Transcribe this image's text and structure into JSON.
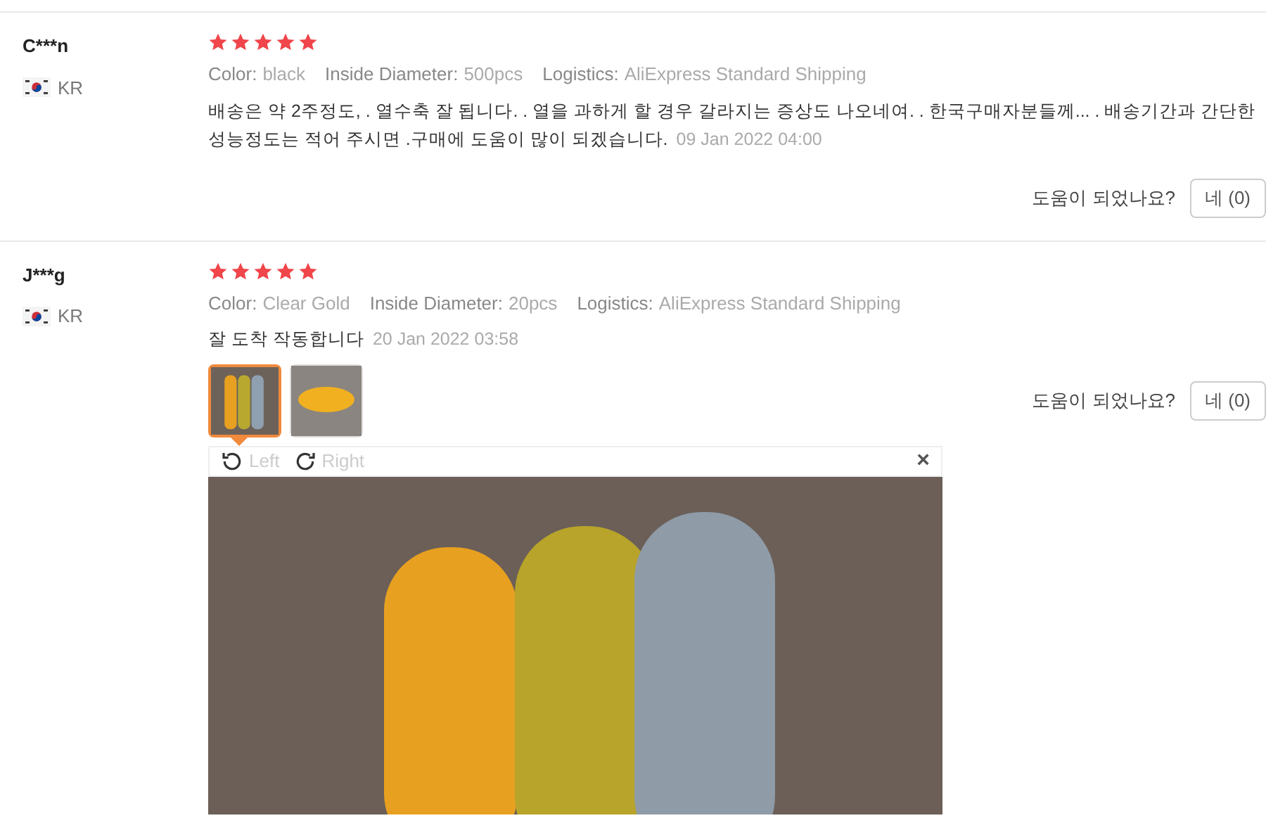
{
  "reviews": [
    {
      "user": "C***n",
      "country": "KR",
      "stars": 5,
      "attributes": [
        {
          "label": "Color:",
          "value": "black"
        },
        {
          "label": "Inside Diameter:",
          "value": "500pcs"
        },
        {
          "label": "Logistics:",
          "value": "AliExpress Standard Shipping"
        }
      ],
      "text": "배송은 약 2주정도, . 열수축 잘 됩니다. . 열을 과하게 할 경우 갈라지는 증상도 나오네여. . 한국구매자분들께... . 배송기간과 간단한 성능정도는 적어 주시면 .구매에 도움이 많이 되겠습니다.",
      "date": "09 Jan 2022 04:00",
      "helpful": "도움이 되었나요?",
      "vote": "네 (0)"
    },
    {
      "user": "J***g",
      "country": "KR",
      "stars": 5,
      "attributes": [
        {
          "label": "Color:",
          "value": "Clear Gold"
        },
        {
          "label": "Inside Diameter:",
          "value": "20pcs"
        },
        {
          "label": "Logistics:",
          "value": "AliExpress Standard Shipping"
        }
      ],
      "text": "잘 도착 작동합니다",
      "date": "20 Jan 2022 03:58",
      "helpful": "도움이 되었나요?",
      "vote": "네 (0)",
      "photos": [
        {
          "kind": "tubes",
          "selected": true
        },
        {
          "kind": "ring",
          "selected": false
        }
      ],
      "viewer": {
        "rotate_left": "Left",
        "rotate_right": "Right",
        "close": "×"
      }
    }
  ]
}
